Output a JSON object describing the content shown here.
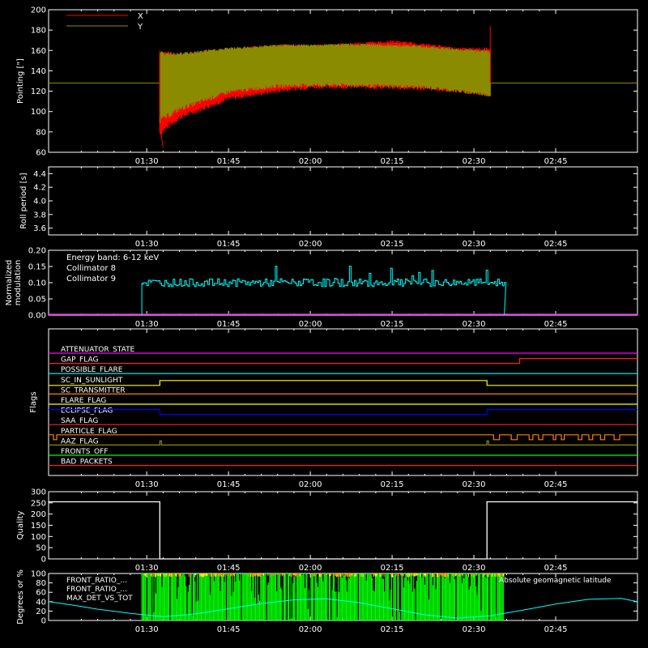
{
  "time_ticks": [
    "01:30",
    "01:45",
    "02:00",
    "02:15",
    "02:30",
    "02:45"
  ],
  "chart_data": [
    {
      "name": "pointing",
      "type": "line",
      "ylabel": "Pointing [\"]",
      "ylim": [
        60,
        200
      ],
      "yticks": [
        "60",
        "80",
        "100",
        "120",
        "140",
        "160",
        "180",
        "200"
      ],
      "legend": [
        {
          "label": "X",
          "color": "#ff0000"
        },
        {
          "label": "Y",
          "color": "#8b8b00"
        }
      ],
      "series": [
        {
          "name": "X",
          "color": "#ff0000",
          "x": [
            1.5,
            1.6,
            1.75,
            1.9,
            2.0,
            2.1,
            2.25,
            2.35,
            2.45,
            2.55
          ],
          "upper": [
            160,
            158,
            162,
            166,
            166,
            167,
            170,
            167,
            163,
            163
          ],
          "lower": [
            60,
            88,
            108,
            116,
            120,
            120,
            119,
            118,
            116,
            112
          ]
        },
        {
          "name": "Y",
          "color": "#8b8b00",
          "x": [
            1.5,
            1.6,
            1.75,
            1.9,
            2.0,
            2.1,
            2.25,
            2.35,
            2.45,
            2.55
          ],
          "upper": [
            160,
            158,
            163,
            166,
            166,
            167,
            166,
            165,
            162,
            160
          ],
          "lower": [
            76,
            97,
            115,
            121,
            122,
            122,
            121,
            120,
            116,
            112
          ]
        }
      ],
      "reference_level": 128,
      "spike": {
        "x": 2.55,
        "y": 184
      }
    },
    {
      "name": "roll",
      "type": "line",
      "ylabel": "Roll period [s]",
      "ylim": [
        3.5,
        4.5
      ],
      "yticks": [
        "3.6",
        "3.8",
        "4.0",
        "4.2",
        "4.4"
      ],
      "series": []
    },
    {
      "name": "modulation",
      "type": "line",
      "ylabel": "Normalized modulation",
      "ylim": [
        0,
        0.2
      ],
      "yticks": [
        "0.00",
        "0.05",
        "0.10",
        "0.15",
        "0.20"
      ],
      "legend_title": "Energy band: 6-12 keV",
      "legend": [
        {
          "label": "Collimator 8",
          "color": "#00ffff"
        },
        {
          "label": "Collimator 9",
          "color": "#ff00ff"
        }
      ],
      "series": [
        {
          "name": "Collimator 8",
          "color": "#00ffff",
          "x_start": 1.485,
          "x_end": 2.593,
          "level": 0.1,
          "noise": 0.012
        },
        {
          "name": "Collimator 9",
          "color": "#ff00ff",
          "level": 0.0
        }
      ]
    },
    {
      "name": "flags",
      "type": "line",
      "ylabel": "Flags",
      "flags": [
        {
          "label": "ATTENUATOR_STATE",
          "color": "#ff00ff"
        },
        {
          "label": "GAP_FLAG",
          "color": "#ff2020"
        },
        {
          "label": "POSSIBLE_FLARE",
          "color": "#00ffff"
        },
        {
          "label": "SC_IN_SUNLIGHT",
          "color": "#ffff00"
        },
        {
          "label": "SC_TRANSMITTER",
          "color": "#ff8000"
        },
        {
          "label": "FLARE_FLAG",
          "color": "#ffff00"
        },
        {
          "label": "ECLIPSE_FLAG",
          "color": "#0000ff"
        },
        {
          "label": "SAA_FLAG",
          "color": "#ff2020"
        },
        {
          "label": "PARTICLE_FLAG",
          "color": "#ff8000"
        },
        {
          "label": "AAZ_FLAG",
          "color": "#8b8b00"
        },
        {
          "label": "FRONTS_OFF",
          "color": "#00ff00"
        },
        {
          "label": "BAD_PACKETS",
          "color": "#ff2020"
        }
      ]
    },
    {
      "name": "quality",
      "type": "line",
      "ylabel": "Quality",
      "ylim": [
        0,
        300
      ],
      "yticks": [
        "0",
        "50",
        "100",
        "150",
        "200",
        "250",
        "300"
      ],
      "series": [
        {
          "name": "Quality",
          "color": "#ffffff",
          "x": [
            1.2,
            1.54,
            1.54,
            2.54,
            2.54,
            3.0
          ],
          "y": [
            255,
            255,
            0,
            0,
            255,
            255
          ]
        }
      ]
    },
    {
      "name": "front_ratio",
      "type": "line",
      "ylabel": "Degrees or %",
      "ylim": [
        0,
        100
      ],
      "yticks": [
        "0",
        "20",
        "40",
        "60",
        "80",
        "100"
      ],
      "legend": [
        {
          "label": "FRONT_RATIO_...",
          "color": "#ffff00"
        },
        {
          "label": "FRONT_RATIO_...",
          "color": "#00ff00"
        },
        {
          "label": "MAX_DET_VS_TOT",
          "color": "#ff8000"
        }
      ],
      "right_legend": {
        "label": "Absolute geomagnetic latitude",
        "color": "#00ffff"
      },
      "series": [
        {
          "name": "Absolute geomagnetic latitude",
          "color": "#00ffff",
          "x": [
            1.2,
            1.28,
            1.35,
            1.45,
            1.55,
            1.65,
            1.75,
            1.85,
            1.95,
            2.05,
            2.15,
            2.25,
            2.35,
            2.45,
            2.55,
            2.65,
            2.75,
            2.85,
            2.95,
            3.0
          ],
          "y": [
            40,
            32,
            24,
            15,
            8,
            14,
            25,
            36,
            44,
            46,
            38,
            25,
            12,
            5,
            10,
            22,
            35,
            45,
            47,
            40
          ]
        },
        {
          "name": "FRONT_RATIO",
          "color": "#00ff00",
          "x_start": 1.485,
          "x_end": 2.593
        }
      ]
    }
  ]
}
